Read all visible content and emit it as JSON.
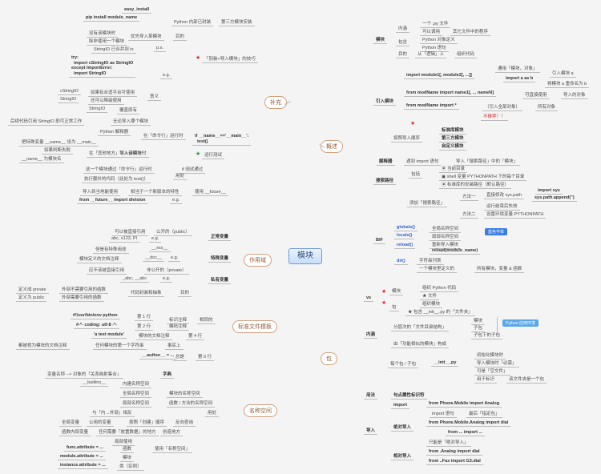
{
  "root": "模块",
  "hubs": {
    "buchong": "补充",
    "zuoyongyu": "作用域",
    "wenjianmuban": "标准文件模板",
    "mingchengkongjian": "名称空间",
    "gaishu": "概述",
    "bao": "包"
  },
  "tags": {
    "lanfangfa": "蓝色字体",
    "yingyonghuanjing": "Python 应用环境"
  },
  "stars": {
    "red": "★",
    "green": "★"
  },
  "buchong": {
    "easy": "easy_install",
    "pip": "pip install module_name",
    "pyneibu": "Python 内部已封装",
    "disanfang": "第三方模块安装",
    "meiyoushi": "没有该模块时",
    "chufeishi": "除非使用一个模块",
    "youxian": "优先导入某模块",
    "mudi": "目的",
    "stringio": "StringIO 已合并到 io",
    "ps": "p.s.",
    "trycode": "try:\n  import cStringIO as StringIO\nexcept ImportError:\n  import StringIO",
    "eg": "e.g.",
    "cstringio": "cStringIO",
    "stringiom": "StringIO",
    "ruguo": "如果有合适平台可使用",
    "haikeyi": "还可以降级使用",
    "yiyi": "意义",
    "fugaiyuanyou": "覆盖原有",
    "houxu": "后续代码引用 StringIO 即可正常工作",
    "wulun": "无论导入哪个模块",
    "pythonjieshi": "Python 解释器",
    "zai": "在「命令行」运行时",
    "batebie": "把特殊变量 __name__ 设为 __main__",
    "ruguoshibai": "如果判断失败",
    "namewei": "__name__ 为模块名",
    "zaiqita": "在「其他地方」导入该模块时",
    "zheyi": "这一个模块通过「命令行」运行时",
    "zhixing": "执行额外的代码（此处为 test()）",
    "daoru": "导入该模块",
    "yongchu": "用处",
    "ifmain": "if __name__=='__main__':\n  test()",
    "iftest": "if 测试通过",
    "yunxingceshi": "运行测试",
    "daorudao": "导入到当地能使用",
    "xiangyu": "相当于一个新版本的特性",
    "shiyong": "使用 __future__",
    "fromf": "from __future__ import division",
    "zhuangdaoru": "「别装+导入模块」的技巧"
  },
  "gaishu": {
    "neihan": "内涵",
    "mokuai": "模块",
    "yigepi": "一个 .py 文件",
    "keyi": "可以调用",
    "qita": "其它文件中的程序",
    "baohan": "包含",
    "pythonduixiang": "Python 对象定义",
    "pythonyuju": "Python 语句",
    "mudi": "目的",
    "cong": "从「逻辑」上",
    "zuzhi": "组织代码",
    "tongyong": "通用「模块，对象」",
    "importm": "import module1[, module2[, ...]]",
    "importab": "import a as b",
    "yinru": "引入模块 a",
    "jianga": "将模块 a 重命名为 b",
    "yinrumokuai": "引入模块",
    "fromm": "from modName import name1[, ... nameN]",
    "kezhijie": "可直接使用",
    "daorude": "导入的对象",
    "frommi": "from modName import *",
    "yinruquanb": "所有对象",
    "butui": "不推荐！！",
    "biaozhun": "标准库模块",
    "disanfang": "第三方模块",
    "zidingyi": "自定义模块",
    "anzhaol": "按照导入顺序",
    "jieshiqi": "解释器",
    "yudao": "遇到 import 语句",
    "daoru": "导入「搜索路径」中的「模块」",
    "sousuoluij": "搜索路径",
    "baokuo": "包括",
    "dangqian": "当前目录",
    "shell": "shell 变量 PYTHONPATH 下的每个目录",
    "biaozhunk": "标准库的安装路径（默认路径）",
    "tianjia": "添加「搜索路径」",
    "fangfa1": "方法一",
    "fangfa2": "方法二",
    "zhijie": "直接修改 sys.path",
    "yunxing": "运行结束后失效",
    "shezhi": "设置环境变量 PYTHONPATH",
    "importsys": "import sys",
    "syspath": "sys.path.append('')",
    "bif": "BIF",
    "globals": "globals()",
    "locals": "locals()",
    "reload": "reload()",
    "dir": "dir()",
    "quanju": "全局名称空间",
    "jubu": "局部名称空间",
    "reloadm": "reload(module_name)",
    "zifu": "字符串列表",
    "yigemo": "一个模块里定义的",
    "suoyou": "所有模块，变量 & 函数"
  },
  "zuoyongyu": {
    "zhengchang": "正常变量",
    "teshu": "特殊变量",
    "siyou": "私有变量",
    "keyi": "可以被直接引用",
    "gongkai": "公开的（public）",
    "abc": "abc, x123, PI",
    "eg": "e.g.",
    "danshi": "但是有特殊用途",
    "xxx": "__xxx__",
    "doc": "__doc__",
    "yingbu": "应不该被直接引用",
    "feikai": "非公开的（private）",
    "abc2": "_abc, __abc",
    "dingyiw": "定义成 private",
    "waibubu": "外部不需要引用的函数",
    "dingyiw2": "定义为 public",
    "waibubi": "外部需要引用的函数",
    "daimafengzhuang": "代码封装和抽象",
    "mudi": "目的",
    "mokuaidingyi": "模块定义的文档注释"
  },
  "wenjian": {
    "l1": "#!/usr/bin/env python",
    "l2": "#-*- coding: utf-8 -*-",
    "l3": "'a test module'",
    "l4": "任何模块的第一个字符串",
    "d1": "第 1 行",
    "d2": "第 2 行",
    "d4": "第 4 行",
    "d6": "第 6 行",
    "biaoshi": "标识注释",
    "bianma": "编码注释",
    "shishang": "事实上",
    "zongshi": "总是",
    "author": "__author__ = ...",
    "shuoming": "模块的文档注释",
    "doushi": "都被视为模块的文档注释"
  },
  "mingcheng": {
    "bianliang": "变量名称 --> 对象的「关系映射集合」",
    "zidian": "字典",
    "builtins": "__builtins__",
    "neijian": "内建名称空间",
    "quanju": "全局名称空间",
    "jubu": "局部名称空间",
    "mokuaiquanju": "模块的名称空间",
    "hanshu": "函数 / 方法的名称空间",
    "quanjubl": "全局变量",
    "hanshubl": "函数内部变量",
    "anzhao": "按照「创建」顺序",
    "yu": "与「内→外部」相反",
    "fangewen": "反向查询",
    "renheshi": "任何需要「放置数据」的地方",
    "jubushi": "局部使用",
    "func": "func.attribute = ...",
    "hanshu2": "函数",
    "module": "module.attribute = ...",
    "mokuai2": "模块",
    "shili": "instance.attribute = ...",
    "lei": "类（实例）",
    "yongtu": "用处",
    "shiyong": "使用「名称空间」"
  },
  "bao": {
    "vs": "vs",
    "mokuai": "模块",
    "zuzhi": "组织 Python 代码",
    "wenjian": "★ 文件",
    "bao2": "包",
    "zuzhi2": "组织模块",
    "baohan": "★ 包含 __init__.py 的「文件夹」",
    "mokuai3": "模块",
    "zibao": "子包",
    "zibaox": "子包下的子包",
    "fenceng": "分层次的「文件目录结构」",
    "neihan": "内涵",
    "you": "由「功能相似的模块」构成",
    "meige": "每个包 / 子包",
    "init": "__init__.py",
    "chushihua": "初始化模块时",
    "daorubixu": "导入模块时「必需」",
    "kezhishi": "可是「空文件」",
    "yongyu": "用于标识",
    "gaiwen": "该文件夹是一个包",
    "yongfa": "用法",
    "judianshu": "句点属性标识符",
    "daoru": "导入",
    "import": "import",
    "fromph": "from Phone.Mobile import Analog",
    "importyuju": "import 语句",
    "zuihou": "最后「指定包」",
    "juedui": "绝对导入",
    "fromphm": "from Phone.Mobile.Analog import dial",
    "fromim": "from ... import ...",
    "zhibao": "只能是「绝对导入」",
    "xiangdui": "相对导入",
    "fromana": "from .Analog import dial",
    "fromfax": "from ..Fax import G3.dial"
  }
}
